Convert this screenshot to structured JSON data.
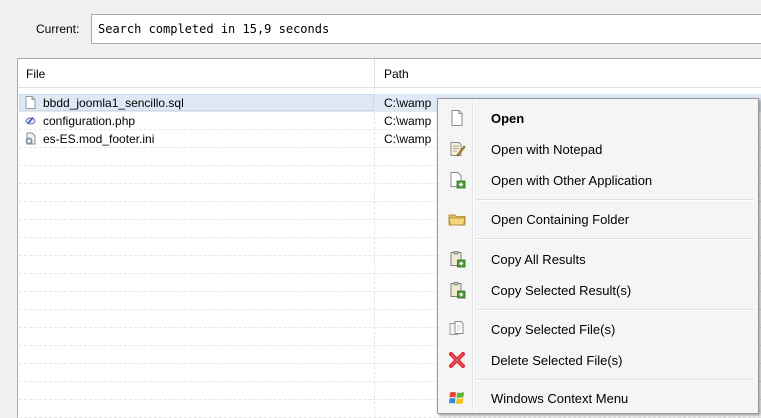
{
  "status": {
    "label": "Current:",
    "value": "Search completed in 15,9 seconds"
  },
  "results": {
    "columns": [
      "File",
      "Path"
    ],
    "rows": [
      {
        "file": "bbdd_joomla1_sencillo.sql",
        "path": "C:\\wamp",
        "icon": "sql-file-icon",
        "selected": true
      },
      {
        "file": "configuration.php",
        "path": "C:\\wamp",
        "icon": "php-file-icon",
        "selected": false
      },
      {
        "file": "es-ES.mod_footer.ini",
        "path": "C:\\wamp",
        "icon": "ini-file-icon",
        "selected": false
      }
    ]
  },
  "context_menu": {
    "items": [
      {
        "label": "Open",
        "icon": "document-icon",
        "bold": true
      },
      {
        "label": "Open with Notepad",
        "icon": "notepad-icon"
      },
      {
        "label": "Open with Other Application",
        "icon": "application-icon"
      },
      {
        "label": "Open Containing Folder",
        "icon": "folder-icon"
      },
      {
        "label": "Copy All Results",
        "icon": "clipboard-add-icon"
      },
      {
        "label": "Copy Selected Result(s)",
        "icon": "clipboard-add-icon"
      },
      {
        "label": "Copy Selected File(s)",
        "icon": "copy-file-icon"
      },
      {
        "label": "Delete Selected File(s)",
        "icon": "delete-icon"
      },
      {
        "label": "Windows Context Menu",
        "icon": "windows-logo-icon"
      }
    ]
  },
  "colors": {
    "selection": "#dfe9f5",
    "menu_background": "#f5f5f5",
    "delete_red": "#d8232a",
    "folder_yellow": "#e8c35a"
  }
}
